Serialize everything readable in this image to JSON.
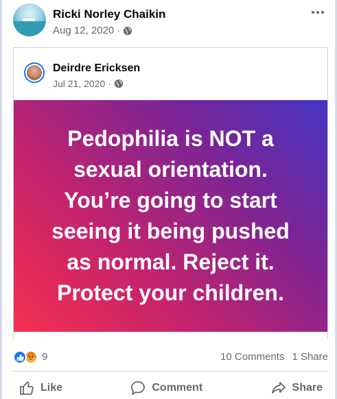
{
  "post": {
    "author": "Ricki Norley Chaikin",
    "date": "Aug 12, 2020",
    "separator": "·",
    "privacy_icon": "globe-icon",
    "more_icon": "more-horizontal-icon"
  },
  "shared_post": {
    "author": "Deirdre Ericksen",
    "date": "Jul 21, 2020",
    "separator": "·",
    "privacy_icon": "globe-icon",
    "text_lines": [
      "Pedophilia is NOT a",
      "sexual orientation.",
      "You’re going to start",
      "seeing it being pushed",
      "as normal. Reject it.",
      "Protect your children."
    ],
    "background_colors": [
      "#f5304f",
      "#c2236e",
      "#7a2596",
      "#4535c4"
    ]
  },
  "engagement": {
    "reactions": [
      "like-reaction-icon",
      "angry-reaction-icon"
    ],
    "reaction_count": "9",
    "comments": "10 Comments",
    "shares": "1 Share"
  },
  "actions": {
    "like": "Like",
    "comment": "Comment",
    "share": "Share"
  },
  "colors": {
    "text": "#050505",
    "secondary": "#65676b",
    "like_blue": "#1877f2",
    "divider": "#ced0d4"
  }
}
